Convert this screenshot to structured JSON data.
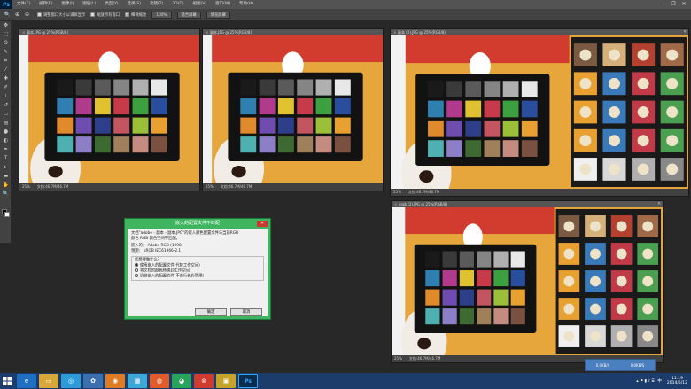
{
  "app": {
    "logo": "Ps",
    "icon": "photoshop-icon"
  },
  "menubar": {
    "items": [
      "文件(F)",
      "编辑(E)",
      "图像(I)",
      "图层(L)",
      "类型(Y)",
      "选择(S)",
      "滤镜(T)",
      "3D(D)",
      "视图(V)",
      "窗口(W)",
      "帮助(H)"
    ]
  },
  "options": {
    "cb_resize": "调整窗口大小以满屏显示",
    "cb_all": "缩放所有窗口",
    "cb_scrubby": "细微缩放",
    "btn_100": "100%",
    "btn_fit": "适合屏幕",
    "btn_fill": "填充屏幕"
  },
  "docs": [
    {
      "tab": "副本.JPG @ 25%(RGB/8)",
      "zoom": "25%",
      "doc": "文档:46.7M/46.7M"
    },
    {
      "tab": "副本.JPG @ 25%(RGB/8)",
      "zoom": "25%",
      "doc": "文档:46.7M/46.7M"
    },
    {
      "tab": "副本 (2).JPG @ 25%(RGB/8)",
      "zoom": "25%",
      "doc": "文档:46.7M/46.7M"
    },
    {
      "tab": "orgb (2).JPG @ 25%(RGB/8)",
      "zoom": "25%",
      "doc": "文档:46.7M/46.7M"
    }
  ],
  "dialog": {
    "title": "嵌入的配置文件不匹配",
    "line1": "文档\"adobe - 副本 - 副本.JPG\"的嵌入颜色配置文件与当前RGB",
    "line2": "颜色 RGB 颜色空间不匹配。",
    "embedded_label": "嵌入的：",
    "embedded_value": "Adobe RGB (1998)",
    "working_label": "预期：",
    "working_value": "sRGB IEC61966-2.1",
    "question": "您想要做什么？",
    "opt1": "使用嵌入的配置文件(代替工作空间)",
    "opt2": "将文档的颜色转换到工作空间",
    "opt3": "扔掉嵌入的配置文件(不进行色彩管理)",
    "ok": "确定",
    "cancel": "取消"
  },
  "taskbar": {
    "time": "11:19",
    "date": "2014/5/12",
    "lang": "中",
    "ime_items": [
      "0.0KB/S",
      "0.0KB/S"
    ]
  }
}
